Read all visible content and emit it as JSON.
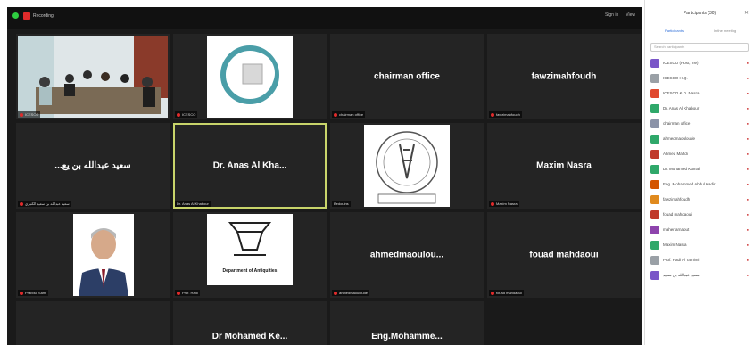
{
  "topbar": {
    "recording_label": "Recording",
    "right_items": [
      "Sign in",
      "View"
    ]
  },
  "tiles": [
    {
      "id": "t1",
      "name": "",
      "label": "ICESCO",
      "kind": "conference-photo"
    },
    {
      "id": "t2",
      "name": "",
      "label": "ICESCO",
      "kind": "logo-icesco"
    },
    {
      "id": "t3",
      "name": "chairman office",
      "label": "chairman office",
      "kind": "text"
    },
    {
      "id": "t4",
      "name": "fawzimahfoudh",
      "label": "fawzimahfoudh",
      "kind": "text"
    },
    {
      "id": "t5",
      "name": "...سعيد عبدالله بن يع",
      "label": "سعيد عبدالله بن سعيد الكثيري",
      "kind": "text"
    },
    {
      "id": "t6",
      "name": "Dr. Anas Al Kha...",
      "label": "Dr. Anas Al Khabour",
      "kind": "text",
      "active": true
    },
    {
      "id": "t7",
      "name": "",
      "label": "Bedouins",
      "kind": "logo-circle"
    },
    {
      "id": "t8",
      "name": "Maxim Nasra",
      "label": "Maxim Nasra",
      "kind": "text"
    },
    {
      "id": "t9",
      "name": "",
      "label": "Prabdul Sami",
      "kind": "portrait"
    },
    {
      "id": "t10",
      "name": "",
      "label": "Prof. Hadi",
      "kind": "logo-antiquities",
      "caption": "Department of Antiquities"
    },
    {
      "id": "t11",
      "name": "ahmedmaoulou...",
      "label": "ahmedmaouloude",
      "kind": "text"
    },
    {
      "id": "t12",
      "name": "fouad mahdaoui",
      "label": "fouad mahdaoui",
      "kind": "text"
    },
    {
      "id": "t13",
      "name": "",
      "label": "",
      "kind": "blank"
    },
    {
      "id": "t14",
      "name": "Dr Mohamed Ke...",
      "label": "",
      "kind": "text"
    },
    {
      "id": "t15",
      "name": "Eng.Mohamme...",
      "label": "",
      "kind": "text"
    }
  ],
  "panel": {
    "title": "Participants (30)",
    "tabs": [
      "Participants",
      "In the meeting"
    ],
    "search_placeholder": "Search participants",
    "participants": [
      {
        "name": "ICESCO (Host, me)",
        "color": "#7a56c8"
      },
      {
        "name": "ICESCO H.Q.",
        "color": "#9aa0a6"
      },
      {
        "name": "ICESCO & D. Nasra",
        "color": "#e0492f"
      },
      {
        "name": "Dr. Anas Al Khabour",
        "color": "#2fa86a"
      },
      {
        "name": "chairman office",
        "color": "#8b93a8"
      },
      {
        "name": "ahmedmaouloude",
        "color": "#2fa86a"
      },
      {
        "name": "Ahmed Mahdi",
        "color": "#c0392b"
      },
      {
        "name": "Dr. Mohamed Kamal",
        "color": "#2fa86a"
      },
      {
        "name": "Eng. Mohammed Abdul Kadir",
        "color": "#d35400"
      },
      {
        "name": "fawzimahfoudh",
        "color": "#e08a1e"
      },
      {
        "name": "fouad mahdaoui",
        "color": "#c0392b"
      },
      {
        "name": "maher arnaout",
        "color": "#8e44ad"
      },
      {
        "name": "Maxim Nasra",
        "color": "#2fa86a"
      },
      {
        "name": "Prof. Hadi Al Tamimi",
        "color": "#9aa0a6"
      },
      {
        "name": "سعيد عبدالله بن سعيد",
        "color": "#7a56c8"
      }
    ]
  }
}
